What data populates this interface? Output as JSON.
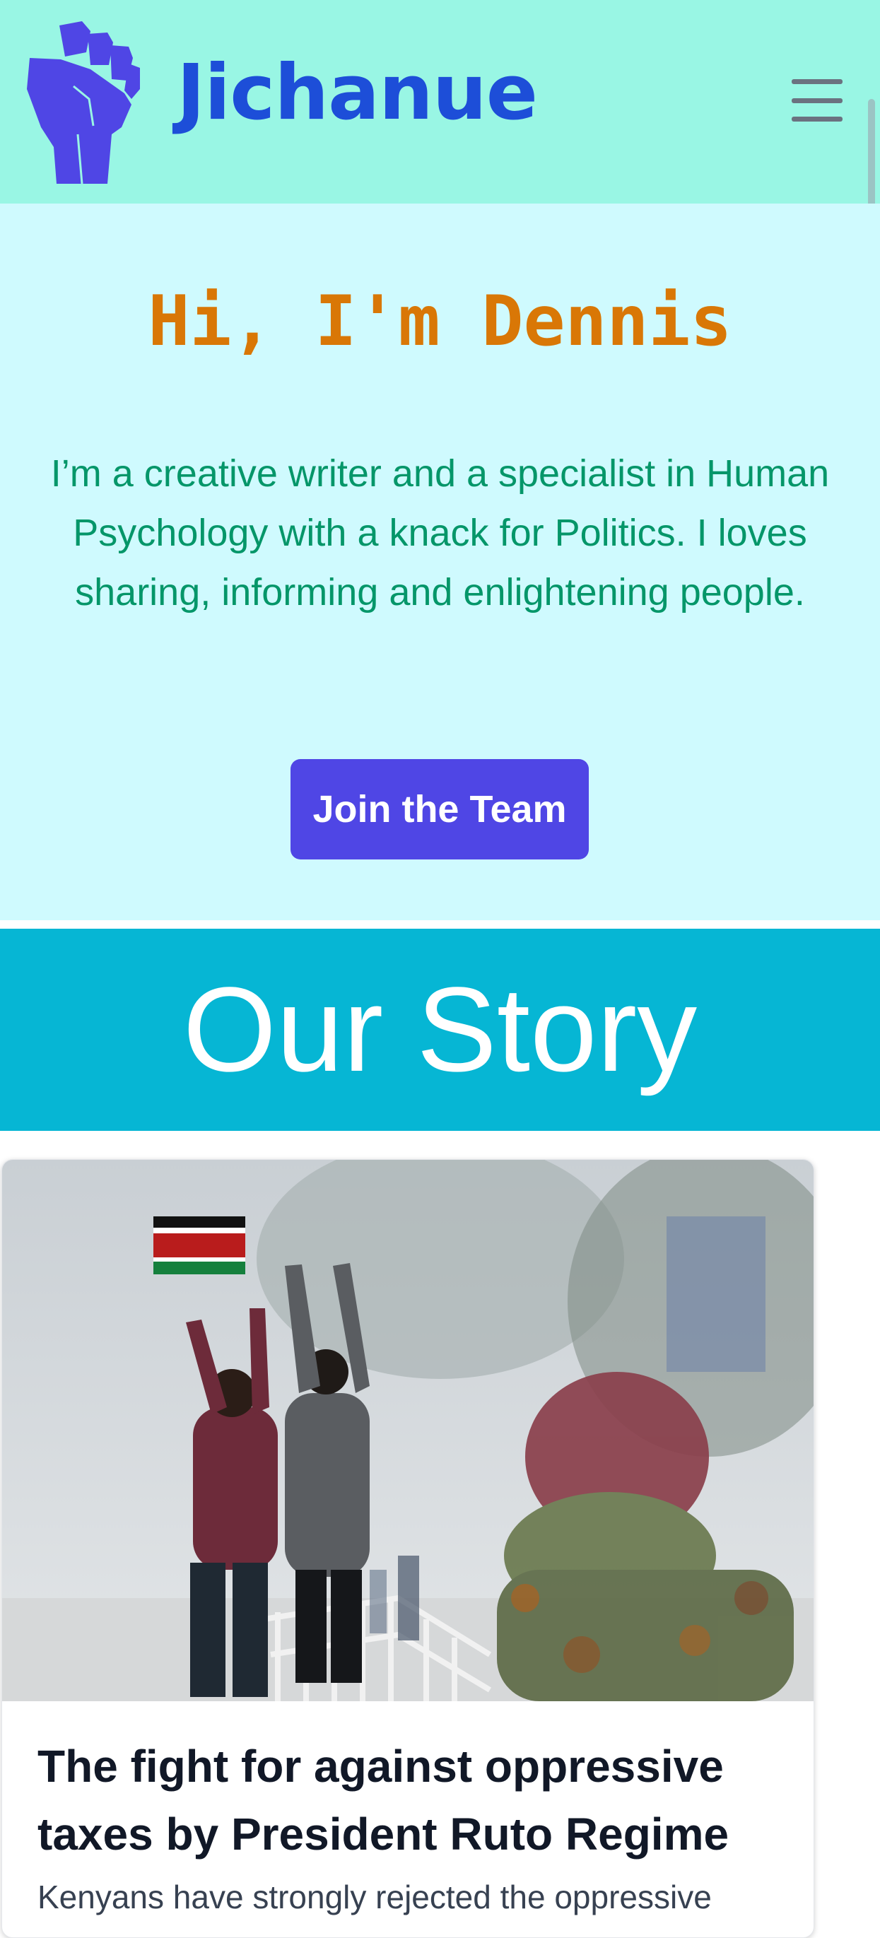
{
  "header": {
    "logo_icon": "raised-fist-icon",
    "brand": "Jichanue",
    "menu_icon": "hamburger-menu-icon"
  },
  "hero": {
    "greeting": "Hi, I'm Dennis",
    "bio": "I’m a creative writer and a specialist in Human Psychology with a knack for Politics. I loves sharing, informing and enlightening people.",
    "cta_label": "Join the Team"
  },
  "story": {
    "heading": "Our Story"
  },
  "article": {
    "title": "The fight for against oppressive taxes by President Ruto Regime",
    "excerpt": "Kenyans have strongly rejected the oppressive"
  },
  "colors": {
    "nav_bg": "#99f6e4",
    "brand": "#1d4ed8",
    "hero_bg": "#cffafe",
    "greeting": "#d97706",
    "bio": "#059669",
    "cta_bg": "#4f46e5",
    "story_bg": "#06b6d4"
  }
}
